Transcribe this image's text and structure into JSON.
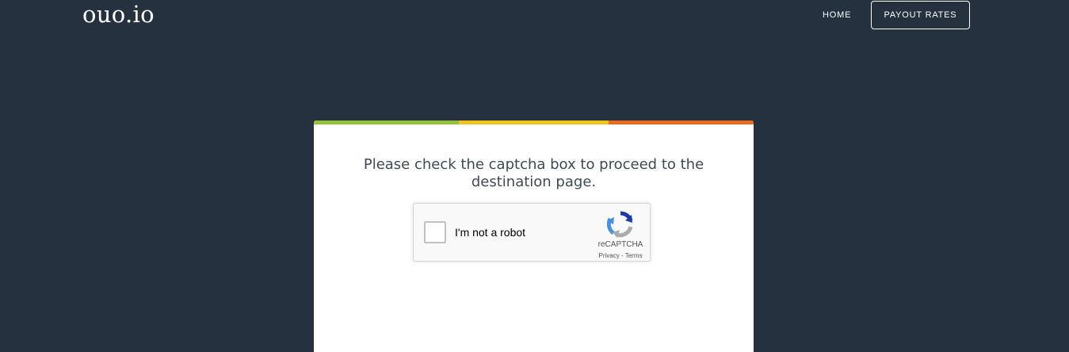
{
  "header": {
    "logo": "ouo.io",
    "nav": {
      "home": "HOME",
      "payout_rates": "PAYOUT RATES"
    }
  },
  "card": {
    "accent_colors": [
      "#95c23c",
      "#f1c21b",
      "#eb6a1f"
    ],
    "message": "Please check the captcha box to proceed to the destination page."
  },
  "recaptcha": {
    "label": "I'm not a robot",
    "brand": "reCAPTCHA",
    "privacy": "Privacy",
    "separator": " - ",
    "terms": "Terms",
    "checked": false
  }
}
